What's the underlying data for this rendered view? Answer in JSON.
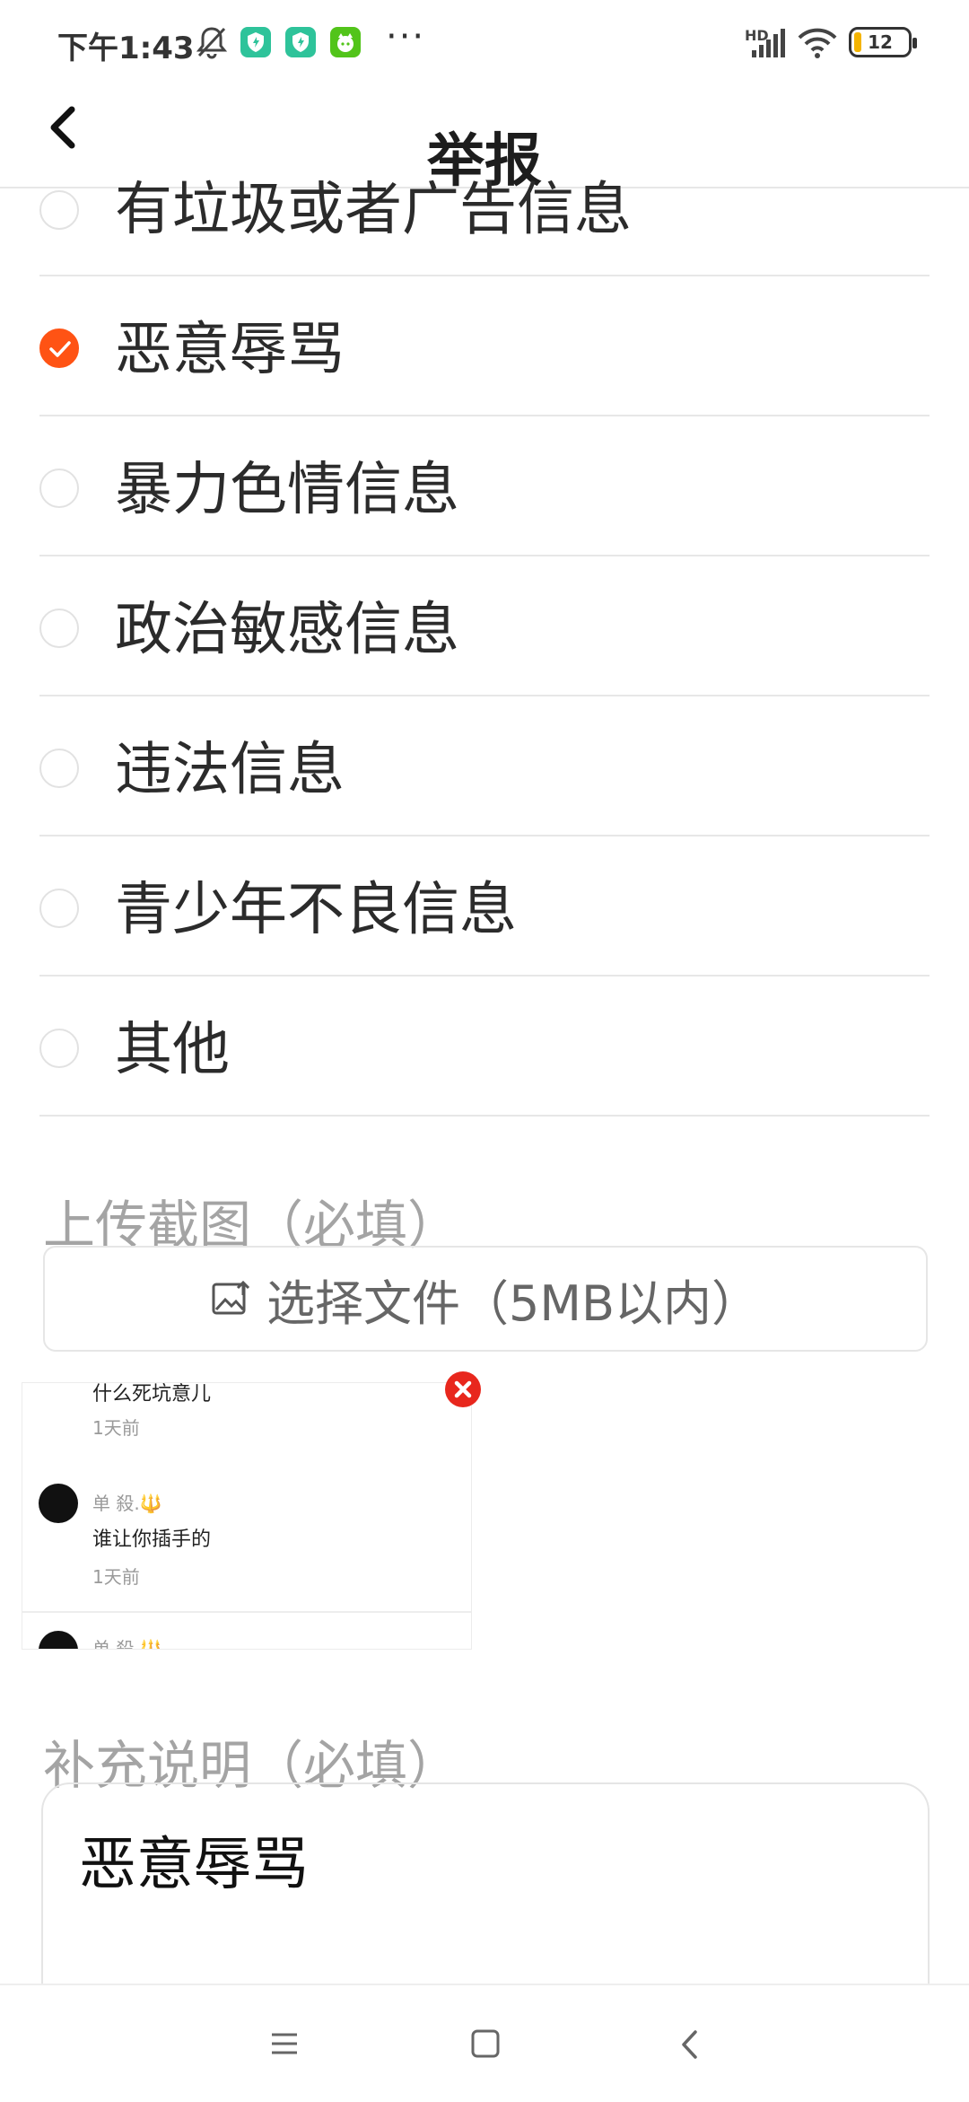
{
  "status_bar": {
    "time": "下午1:43",
    "battery": "12",
    "hd": "HD",
    "more": "···"
  },
  "header": {
    "title": "举报"
  },
  "options": [
    {
      "label": "有垃圾或者广告信息",
      "checked": false
    },
    {
      "label": "恶意辱骂",
      "checked": true
    },
    {
      "label": "暴力色情信息",
      "checked": false
    },
    {
      "label": "政治敏感信息",
      "checked": false
    },
    {
      "label": "违法信息",
      "checked": false
    },
    {
      "label": "青少年不良信息",
      "checked": false
    },
    {
      "label": "其他",
      "checked": false
    }
  ],
  "upload": {
    "section_title": "上传截图（必填）",
    "button_label": "选择文件（5MB以内）"
  },
  "thumbnail": {
    "top_text": "什么死坑意儿",
    "time1": "1天前",
    "user": "单 殺.🔱",
    "comment": "谁让你插手的",
    "time2": "1天前",
    "user2": "单 殺.🔱"
  },
  "description": {
    "section_title": "补充说明（必填）",
    "value": "恶意辱骂"
  },
  "colors": {
    "accent": "#ff5314",
    "status_green": "#2ec39a",
    "remove_red": "#e8271d"
  }
}
